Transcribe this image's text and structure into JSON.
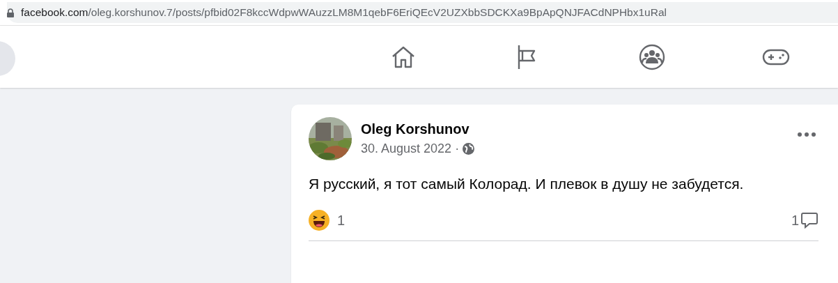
{
  "address_bar": {
    "host": "facebook.com",
    "path": "/oleg.korshunov.7/posts/pfbid02F8kccWdpwWAuzzLM8M1qebF6EriQEcV2UZXbbSDCKXa9BpApQNJFACdNPHbx1uRal"
  },
  "nav": [
    {
      "kind": "home"
    },
    {
      "kind": "pages"
    },
    {
      "kind": "groups"
    },
    {
      "kind": "gaming"
    }
  ],
  "post": {
    "author": "Oleg Korshunov",
    "date": "30. August 2022",
    "separator": "·",
    "text": "Я русский, я тот самый Колорад. И плевок в душу не забудется.",
    "reaction_count": "1",
    "comment_count": "1"
  }
}
